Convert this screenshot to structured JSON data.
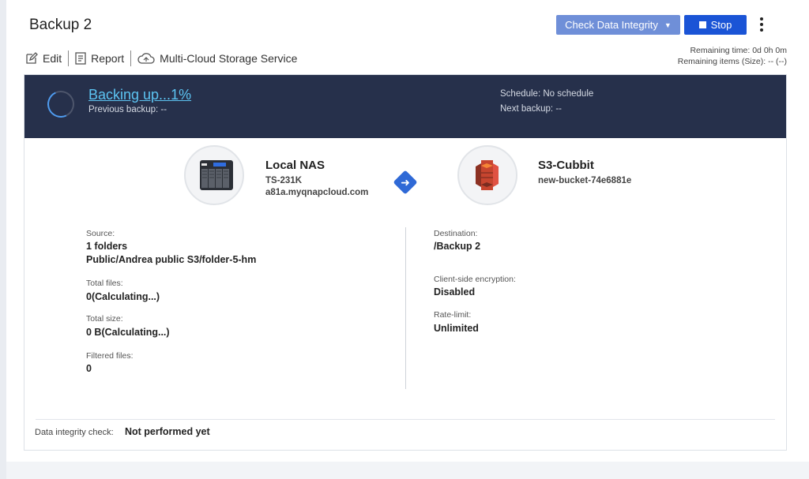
{
  "header": {
    "title": "Backup 2",
    "check_button": "Check Data Integrity",
    "stop_button": "Stop",
    "remaining_time": "Remaining time: 0d 0h 0m",
    "remaining_items": "Remaining items (Size): -- (--)"
  },
  "toolbar": {
    "edit": "Edit",
    "report": "Report",
    "multicloud": "Multi-Cloud Storage Service"
  },
  "status": {
    "text": "Backing up...1%",
    "previous_backup": "Previous backup: --",
    "schedule": "Schedule: No schedule",
    "next_backup": "Next backup: --"
  },
  "source_node": {
    "title": "Local NAS",
    "model": "TS-231K",
    "host": "a81a.myqnapcloud.com"
  },
  "dest_node": {
    "title": "S3-Cubbit",
    "bucket": "new-bucket-74e6881e"
  },
  "details_left": {
    "source_label": "Source:",
    "source_count": "1 folders",
    "source_path": "Public/Andrea public S3/folder-5-hm",
    "total_files_label": "Total files:",
    "total_files": "0(Calculating...)",
    "total_size_label": "Total size:",
    "total_size": "0 B(Calculating...)",
    "filtered_label": "Filtered files:",
    "filtered": "0"
  },
  "details_right": {
    "dest_label": "Destination:",
    "dest": "/Backup 2",
    "encryption_label": "Client-side encryption:",
    "encryption": "Disabled",
    "rate_label": "Rate-limit:",
    "rate": "Unlimited"
  },
  "integrity": {
    "label": "Data integrity check:",
    "value": "Not performed yet"
  },
  "colors": {
    "banner": "#26304b",
    "accent": "#1a54d6",
    "check_button": "#6f8fd8",
    "status_link": "#5cc4f2"
  }
}
